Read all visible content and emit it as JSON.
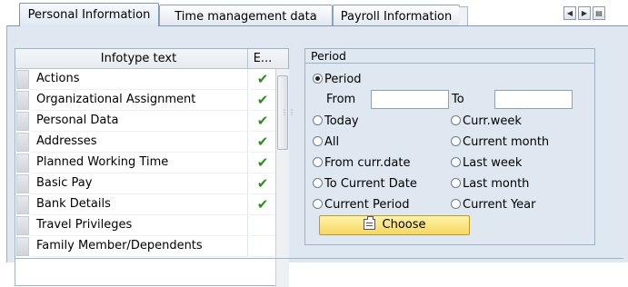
{
  "tabs": [
    {
      "label": "Personal Information",
      "active": true
    },
    {
      "label": "Time management data",
      "active": false
    },
    {
      "label": "Payroll Information",
      "active": false
    }
  ],
  "tab_scroll": {
    "left_icon": "triangle-left-icon",
    "right_icon": "triangle-right-icon",
    "menu_icon": "tab-list-icon"
  },
  "infotype_table": {
    "col_text": "Infotype text",
    "col_exists": "E...",
    "rows": [
      {
        "text": "Actions",
        "exists": true
      },
      {
        "text": "Organizational Assignment",
        "exists": true
      },
      {
        "text": "Personal Data",
        "exists": true
      },
      {
        "text": "Addresses",
        "exists": true
      },
      {
        "text": "Planned Working Time",
        "exists": true
      },
      {
        "text": "Basic Pay",
        "exists": true
      },
      {
        "text": "Bank Details",
        "exists": true
      },
      {
        "text": "Travel Privileges",
        "exists": false
      },
      {
        "text": "Family Member/Dependents",
        "exists": false
      }
    ],
    "check_glyph": "✔"
  },
  "period": {
    "title": "Period",
    "period_option": "Period",
    "from_label": "From",
    "to_label": "To",
    "from_value": "",
    "to_value": "",
    "options_left": [
      "Today",
      "All",
      "From curr.date",
      "To Current Date",
      "Current Period"
    ],
    "options_right": [
      "Curr.week",
      "Current month",
      "Last week",
      "Last month",
      "Current Year"
    ],
    "selected": "Period",
    "choose_label": "Choose"
  },
  "colors": {
    "panel_bg": "#dfe7f0",
    "button_yellow": "#f6d862",
    "check_green": "#2e8b22"
  }
}
